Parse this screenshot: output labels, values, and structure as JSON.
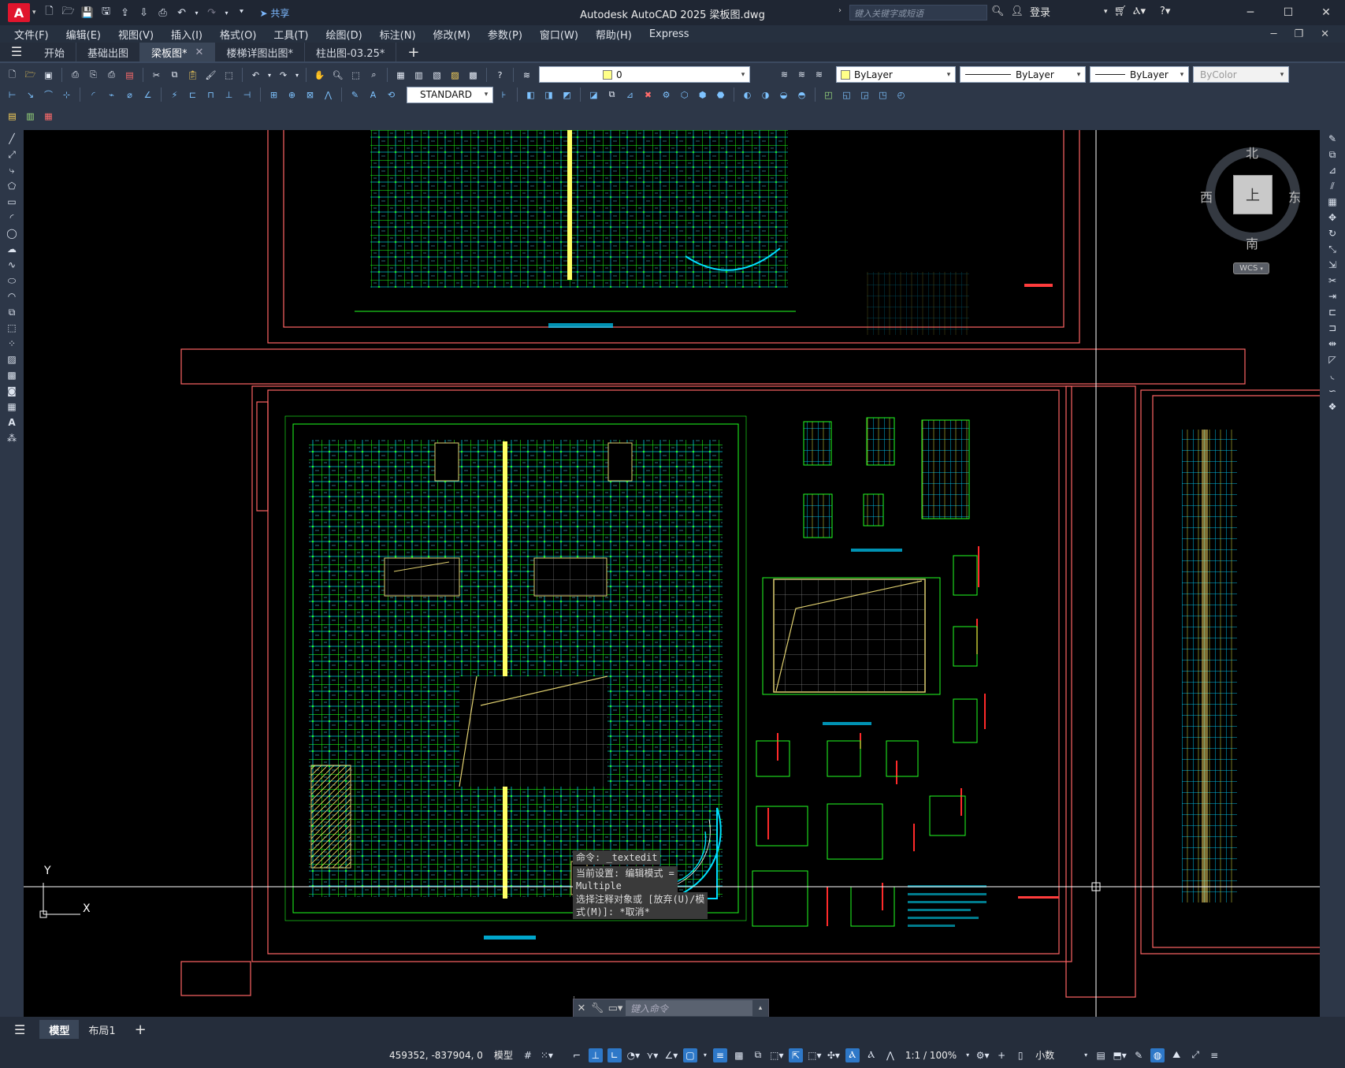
{
  "app": {
    "logo": "A",
    "title": "Autodesk AutoCAD 2025    梁板图.dwg",
    "share_label": "共享",
    "search_placeholder": "键入关键字或短语",
    "login_label": "登录"
  },
  "window_buttons": {
    "minimize": "─",
    "maximize": "☐",
    "close": "✕"
  },
  "menu": [
    "文件(F)",
    "编辑(E)",
    "视图(V)",
    "插入(I)",
    "格式(O)",
    "工具(T)",
    "绘图(D)",
    "标注(N)",
    "修改(M)",
    "参数(P)",
    "窗口(W)",
    "帮助(H)",
    "Express"
  ],
  "file_tabs": [
    {
      "label": "开始",
      "active": false,
      "closable": false
    },
    {
      "label": "基础出图",
      "active": false,
      "closable": false
    },
    {
      "label": "梁板图*",
      "active": true,
      "closable": true
    },
    {
      "label": "楼梯详图出图*",
      "active": false,
      "closable": false
    },
    {
      "label": "柱出图-03.25*",
      "active": false,
      "closable": false
    }
  ],
  "properties": {
    "layer_value": "0",
    "color_value": "ByLayer",
    "linetype_value": "ByLayer",
    "lineweight_value": "ByLayer",
    "plotstyle_value": "ByColor",
    "textstyle_value": "STANDARD"
  },
  "viewcube": {
    "north": "北",
    "south": "南",
    "east": "东",
    "west": "西",
    "top": "上",
    "wcs": "WCS"
  },
  "ucs": {
    "x": "X",
    "y": "Y"
  },
  "command": {
    "history": [
      "命令: _textedit",
      "当前设置: 编辑模式 =\nMultiple",
      "选择注释对象或 [放弃(U)/模\n式(M)]: *取消*"
    ],
    "placeholder": "键入命令"
  },
  "layout_tabs": [
    "模型",
    "布局1"
  ],
  "status": {
    "coords": "459352, -837904, 0",
    "space": "模型",
    "scale": "1:1 / 100%",
    "units": "小数"
  },
  "colors": {
    "accent": "#2e78c8",
    "frame_red": "#ff5a5a",
    "grid_green": "#19ff19",
    "cyan": "#00e5ff",
    "yellow": "#ffff66"
  }
}
